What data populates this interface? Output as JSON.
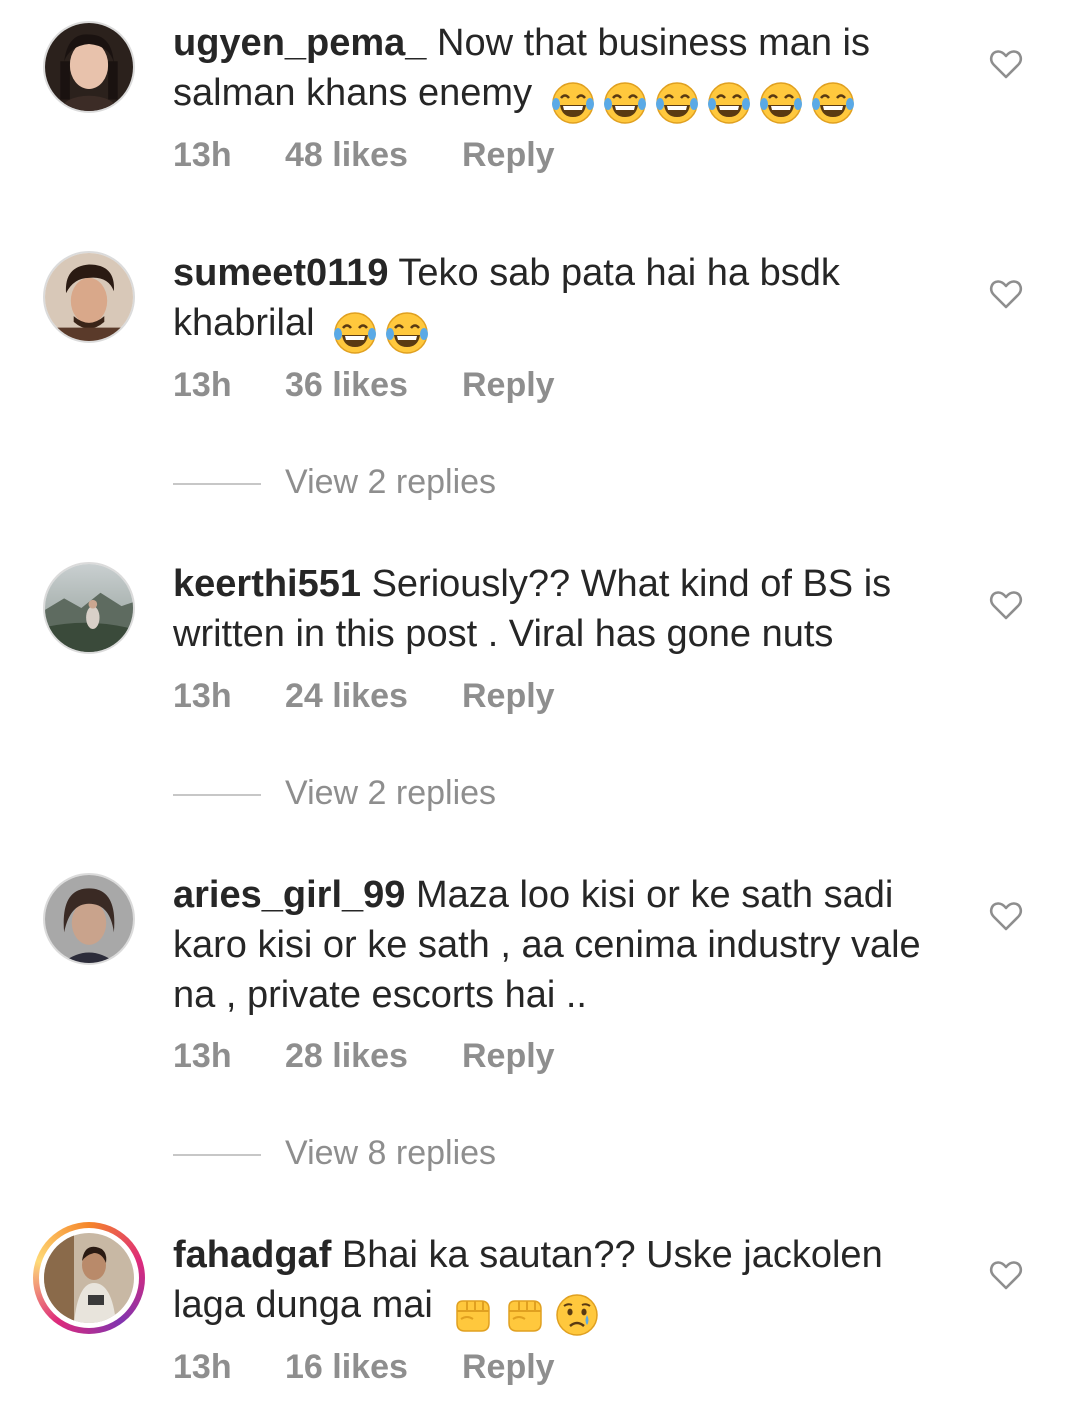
{
  "comments": [
    {
      "username": "ugyen_pema_",
      "text": "Now that business man is salman khans enemy",
      "emoji_icons": [
        "laughing-crying-emoji-icon",
        "laughing-crying-emoji-icon",
        "laughing-crying-emoji-icon",
        "laughing-crying-emoji-icon",
        "laughing-crying-emoji-icon",
        "laughing-crying-emoji-icon"
      ],
      "time": "13h",
      "likes": "48 likes",
      "reply": "Reply",
      "avatar_color": "#3a2a22"
    },
    {
      "username": "sumeet0119",
      "text": "Teko sab pata hai ha bsdk khabrilal",
      "emoji_icons": [
        "laughing-crying-emoji-icon",
        "laughing-crying-emoji-icon"
      ],
      "time": "13h",
      "likes": "36 likes",
      "reply": "Reply",
      "view_replies": "View 2 replies",
      "avatar_color": "#5a3a2a"
    },
    {
      "username": "keerthi551",
      "text": "Seriously?? What kind of BS is written in this post . Viral has gone nuts",
      "emoji_icons": [],
      "time": "13h",
      "likes": "24 likes",
      "reply": "Reply",
      "view_replies": "View 2 replies",
      "avatar_color": "#6a7a6a"
    },
    {
      "username": "aries_girl_99",
      "text": "Maza loo kisi or ke sath sadi karo kisi or ke sath , aa cenima industry vale na , private escorts hai ..",
      "emoji_icons": [],
      "time": "13h",
      "likes": "28 likes",
      "reply": "Reply",
      "view_replies": "View 8 replies",
      "avatar_color": "#8a8a8a"
    },
    {
      "username": "fahadgaf",
      "text": "Bhai ka sautan?? Uske jackolen laga dunga mai",
      "emoji_icons": [
        "oncoming-fist-emoji-icon",
        "oncoming-fist-emoji-icon",
        "crying-face-emoji-icon"
      ],
      "time": "13h",
      "likes": "16 likes",
      "reply": "Reply",
      "avatar_color": "#b0a090"
    }
  ],
  "colors": {
    "text": "#262626",
    "secondary_text": "#8e8e8e",
    "divider": "#c7c7c7",
    "emoji_yellow": "#ffc83d",
    "tear_blue": "#5aa9e6"
  }
}
